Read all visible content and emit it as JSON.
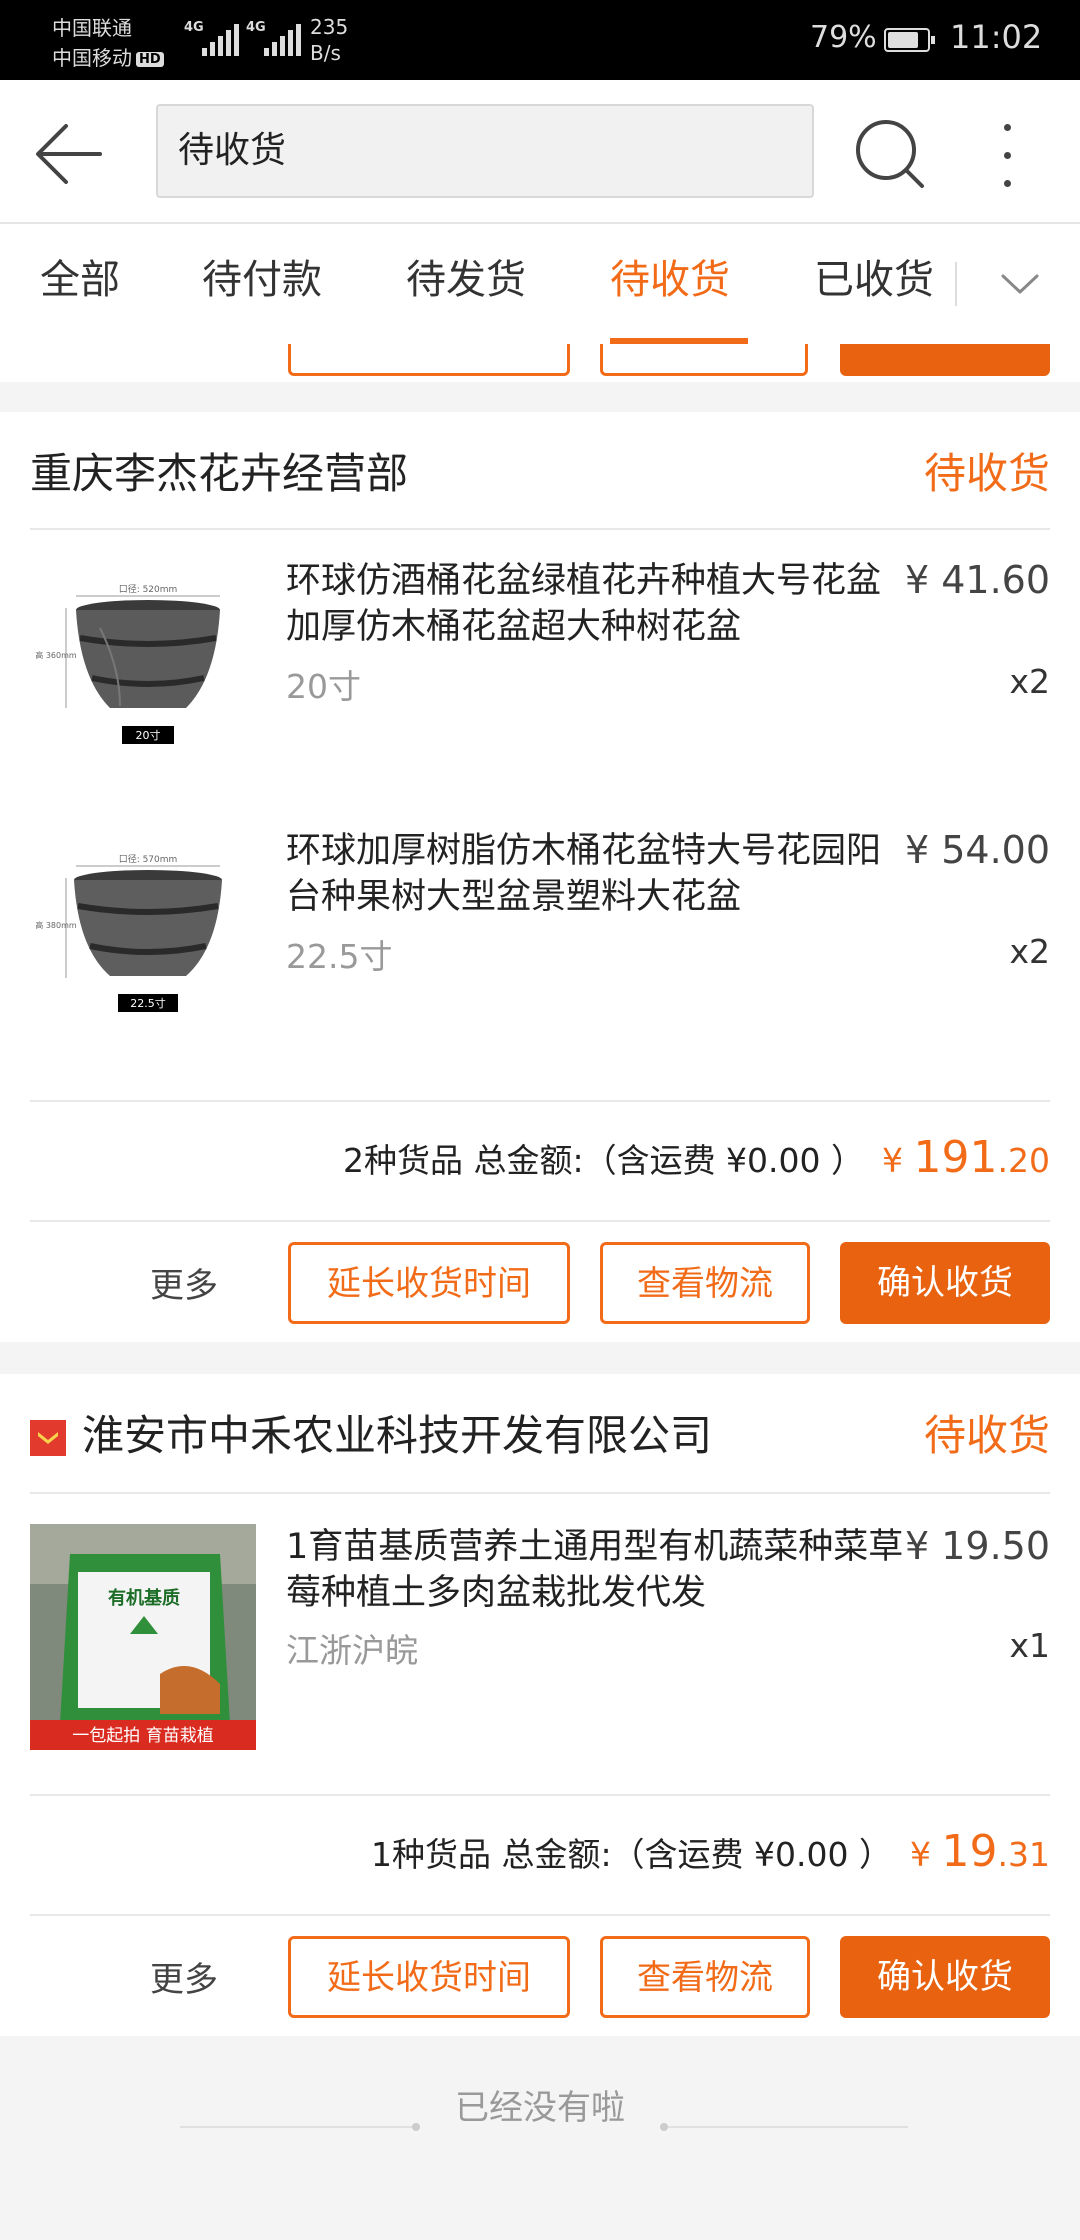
{
  "status_bar": {
    "carrier1": "中国联通",
    "carrier2": "中国移动",
    "hd": "HD",
    "signal1_label": "4G",
    "signal2_label": "4G",
    "net_speed_value": "235",
    "net_speed_unit": "B/s",
    "battery_percent": "79%",
    "battery_level": 0.79,
    "time": "11:02"
  },
  "header": {
    "search_text": "待收货",
    "icons": [
      "back-arrow-icon",
      "search-icon",
      "more-vertical-icon"
    ]
  },
  "tabs": {
    "items": [
      "全部",
      "待付款",
      "待发货",
      "待收货",
      "已收货"
    ],
    "active_index": 3,
    "dropdown_icon": "chevron-down-icon"
  },
  "colors": {
    "accent": "#f26b18",
    "button_fill": "#e8620f",
    "status_bar": "#000000"
  },
  "orders": [
    {
      "shop": "重庆李杰花卉经营部",
      "status": "待收货",
      "items": [
        {
          "title": "环球仿酒桶花盆绿植花卉种植大号花盆加厚仿木桶花盆超大种树花盆",
          "spec": "20寸",
          "price": "¥ 41.60",
          "qty": "x2",
          "thumb_label": "20寸",
          "thumb_dim_top": "口径: 520mm",
          "thumb_dim_side": "高 360mm"
        },
        {
          "title": "环球加厚树脂仿木桶花盆特大号花园阳台种果树大型盆景塑料大花盆",
          "spec": "22.5寸",
          "price": "¥ 54.00",
          "qty": "x2",
          "thumb_label": "22.5寸",
          "thumb_dim_top": "口径: 570mm",
          "thumb_dim_side": "高 380mm"
        }
      ],
      "summary_text": "2种货品 总金额:（含运费 ¥0.00 ）",
      "total_yen": "¥",
      "total_int": "191",
      "total_dec": ".20",
      "more": "更多",
      "buttons": [
        "延长收货时间",
        "查看物流",
        "确认收货"
      ]
    },
    {
      "shop": "淮安市中禾农业科技开发有限公司",
      "status": "待收货",
      "shop_icon": "shop-badge-icon",
      "items": [
        {
          "title": "1育苗基质营养土通用型有机蔬菜种菜草莓种植土多肉盆栽批发代发",
          "spec": "江浙沪皖",
          "price": "¥ 19.50",
          "qty": "x1",
          "thumb_bag_text": "有机基质",
          "thumb_banner": "一包起拍 育苗栽植"
        }
      ],
      "summary_text": "1种货品 总金额:（含运费 ¥0.00 ）",
      "total_yen": "¥",
      "total_int": "19",
      "total_dec": ".31",
      "more": "更多",
      "buttons": [
        "延长收货时间",
        "查看物流",
        "确认收货"
      ]
    }
  ],
  "footer": {
    "end_text": "已经没有啦"
  }
}
